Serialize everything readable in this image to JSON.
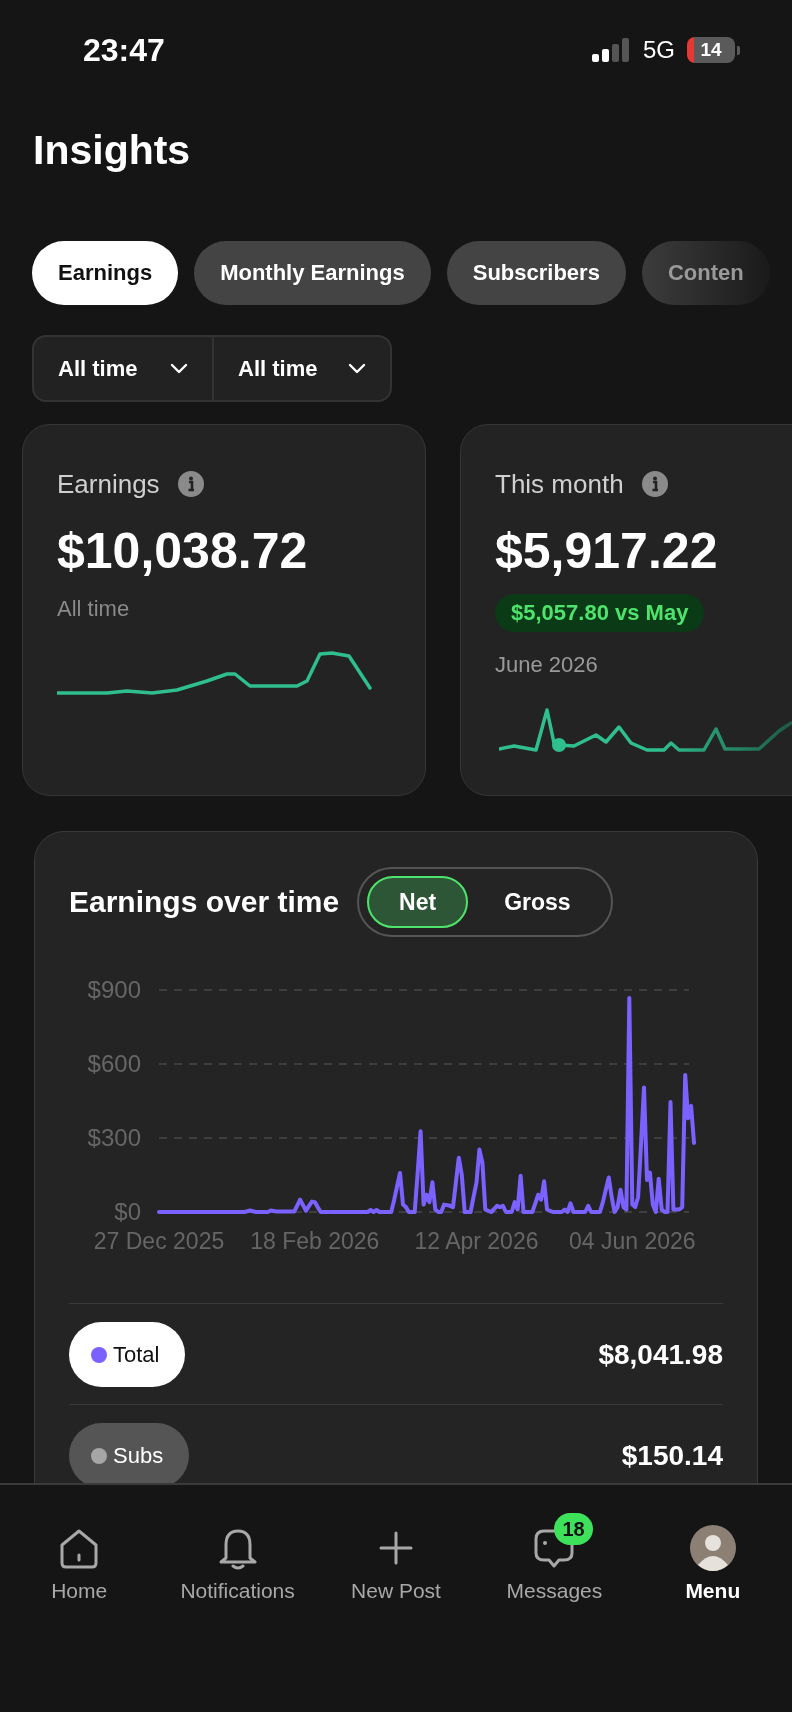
{
  "status_bar": {
    "time": "23:47",
    "network": "5G",
    "battery": "14"
  },
  "title": "Insights",
  "tabs": [
    {
      "label": "Earnings",
      "selected": true
    },
    {
      "label": "Monthly Earnings",
      "selected": false
    },
    {
      "label": "Subscribers",
      "selected": false
    },
    {
      "label": "Conten",
      "selected": false
    }
  ],
  "filters": [
    {
      "label": "All time"
    },
    {
      "label": "All time"
    }
  ],
  "stat_cards": [
    {
      "label": "Earnings",
      "value": "$10,038.72",
      "subtitle": "All time"
    },
    {
      "label": "This month",
      "value": "$5,917.22",
      "change": "$5,057.80 vs May",
      "subtitle": "June 2026"
    }
  ],
  "earnings_chart": {
    "title": "Earnings over time",
    "toggle": [
      {
        "label": "Net",
        "selected": true
      },
      {
        "label": "Gross",
        "selected": false
      }
    ],
    "chart_data": {
      "type": "line",
      "ylim": [
        0,
        900
      ],
      "categories": [
        "27 Dec 2025",
        null,
        null,
        null,
        null,
        null,
        null,
        null,
        null,
        null,
        null,
        null,
        null,
        null,
        null,
        null,
        null,
        null,
        null,
        null,
        null,
        null,
        null,
        null,
        null,
        null,
        null,
        null,
        null,
        null,
        null,
        null,
        null,
        null,
        null,
        null,
        null,
        null,
        null,
        null,
        null,
        null,
        null,
        null,
        null,
        null,
        null,
        null,
        null,
        null,
        null,
        null,
        null,
        "18 Feb 2026",
        null,
        null,
        null,
        null,
        null,
        null,
        null,
        null,
        null,
        null,
        null,
        null,
        null,
        null,
        null,
        null,
        null,
        null,
        null,
        null,
        null,
        null,
        null,
        null,
        null,
        null,
        null,
        null,
        null,
        null,
        null,
        null,
        null,
        null,
        null,
        null,
        null,
        null,
        null,
        null,
        null,
        null,
        null,
        null,
        null,
        null,
        null,
        null,
        null,
        null,
        null,
        null,
        null,
        null,
        "12 Apr 2026",
        null,
        null,
        null,
        null,
        null,
        null,
        null,
        null,
        null,
        null,
        null,
        null,
        null,
        null,
        null,
        null,
        null,
        null,
        null,
        null,
        null,
        null,
        null,
        null,
        null,
        null,
        null,
        null,
        null,
        null,
        null,
        null,
        null,
        null,
        null,
        null,
        null,
        null,
        null,
        null,
        null,
        null,
        null,
        null,
        null,
        null,
        null,
        null,
        null,
        null,
        null,
        null,
        "04 Jun 2026",
        null,
        null,
        null,
        null,
        null,
        null,
        null,
        null,
        null,
        null,
        null,
        null,
        null,
        null,
        null,
        null,
        null,
        null,
        null,
        null,
        null
      ],
      "series": [
        {
          "color": "#7b61ff",
          "values": [
            0,
            0,
            0,
            0,
            0,
            0,
            0,
            0,
            0,
            0,
            0,
            0,
            0,
            0,
            0,
            0,
            0,
            0,
            0,
            0,
            0,
            0,
            0,
            0,
            0,
            0,
            0,
            0,
            0,
            0,
            3,
            6,
            3,
            0,
            0,
            0,
            0,
            0,
            6,
            4,
            2,
            2,
            2,
            2,
            2,
            2,
            2,
            26,
            50,
            28,
            5,
            24,
            42,
            40,
            20,
            0,
            0,
            0,
            0,
            0,
            0,
            0,
            0,
            0,
            0,
            0,
            0,
            0,
            0,
            0,
            0,
            0,
            8,
            0,
            8,
            0,
            0,
            0,
            0,
            0,
            50,
            105,
            158,
            30,
            20,
            0,
            0,
            0,
            160,
            327,
            30,
            70,
            40,
            121,
            10,
            0,
            0,
            30,
            28,
            25,
            20,
            120,
            220,
            150,
            0,
            0,
            0,
            60,
            120,
            253,
            200,
            10,
            5,
            0,
            12,
            25,
            20,
            25,
            0,
            0,
            0,
            40,
            10,
            147,
            0,
            0,
            0,
            0,
            35,
            70,
            50,
            125,
            10,
            5,
            0,
            0,
            0,
            0,
            10,
            0,
            35,
            0,
            0,
            0,
            0,
            0,
            25,
            0,
            0,
            0,
            0,
            40,
            90,
            140,
            60,
            0,
            20,
            90,
            20,
            10,
            868,
            30,
            20,
            60,
            280,
            505,
            130,
            160,
            30,
            0,
            135,
            10,
            0,
            0,
            446,
            10,
            10,
            10,
            20,
            556,
            380,
            430,
            280
          ]
        }
      ],
      "yticks": [
        {
          "value": 0,
          "label": "$0"
        },
        {
          "value": 300,
          "label": "$300"
        },
        {
          "value": 600,
          "label": "$600"
        },
        {
          "value": 900,
          "label": "$900"
        }
      ]
    },
    "legend": [
      {
        "label": "Total",
        "value": "$8,041.98",
        "color": "#7b61ff",
        "selected": true
      },
      {
        "label": "Subs",
        "value": "$150.14",
        "color": "#a6a6a6",
        "selected": false
      }
    ]
  },
  "nav": [
    {
      "label": "Home",
      "selected": false
    },
    {
      "label": "Notifications",
      "selected": false
    },
    {
      "label": "New Post",
      "selected": false
    },
    {
      "label": "Messages",
      "selected": false,
      "badge": "18"
    },
    {
      "label": "Menu",
      "selected": true
    }
  ]
}
